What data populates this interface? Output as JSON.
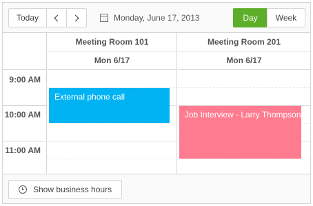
{
  "toolbar": {
    "today_label": "Today",
    "date_text": "Monday, June 17, 2013",
    "views": [
      {
        "label": "Day",
        "selected": true
      },
      {
        "label": "Week",
        "selected": false
      }
    ]
  },
  "columns": [
    {
      "resource": "Meeting Room 101",
      "date": "Mon 6/17"
    },
    {
      "resource": "Meeting Room 201",
      "date": "Mon 6/17"
    }
  ],
  "time_slots": [
    "9:00 AM",
    "10:00 AM",
    "11:00 AM"
  ],
  "events": [
    {
      "title": "External phone call",
      "room": "Meeting Room 101",
      "color": "#02b3f3"
    },
    {
      "title": "Job Interview - Larry Thompson",
      "room": "Meeting Room 201",
      "color": "#ff7b8f"
    }
  ],
  "footer": {
    "business_hours_label": "Show business hours"
  },
  "colors": {
    "accent": "#5dae29"
  },
  "icons": {
    "prev": "chevron-left-icon",
    "next": "chevron-right-icon",
    "calendar": "calendar-icon",
    "clock": "clock-icon"
  }
}
